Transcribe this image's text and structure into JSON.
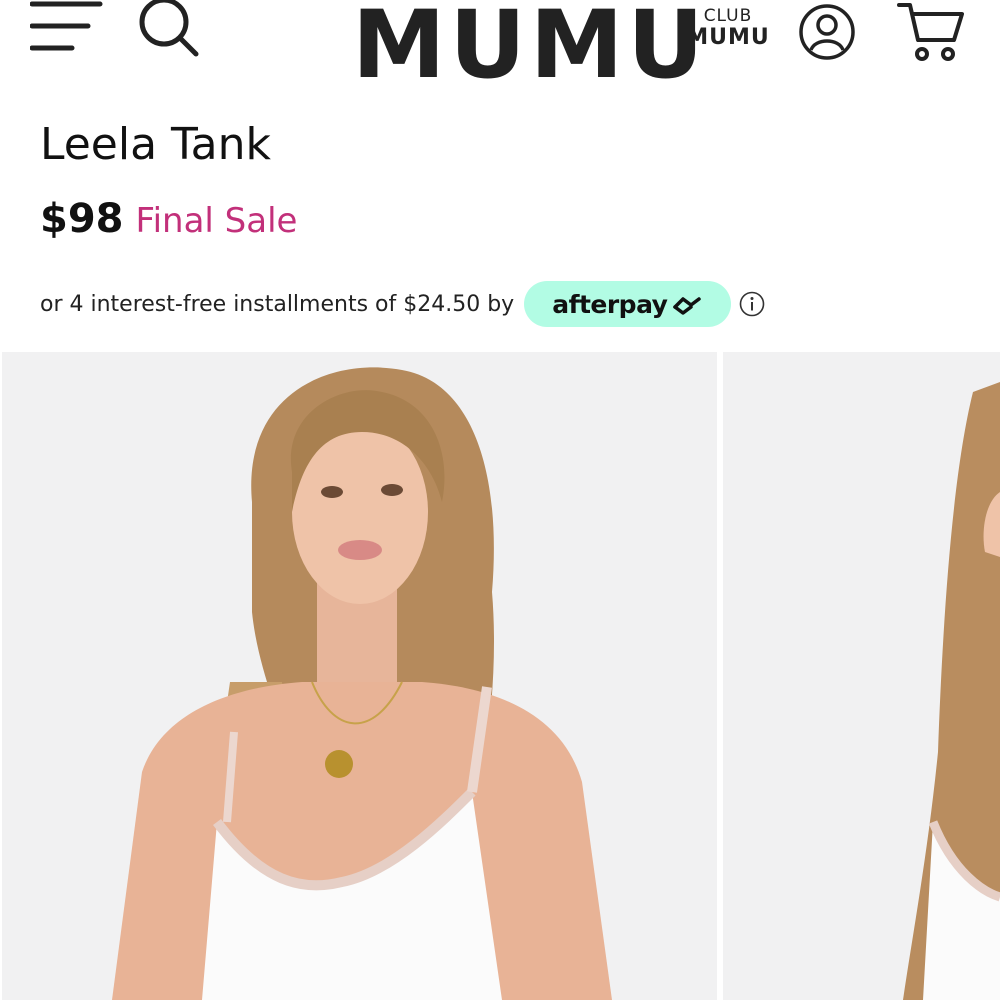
{
  "header": {
    "logo": "MUMU",
    "club_line1": "CLUB",
    "club_line2": "MUMU",
    "icons": [
      "menu-icon",
      "search-icon",
      "account-icon",
      "cart-icon"
    ]
  },
  "product": {
    "name": "Leela Tank",
    "price": "$98",
    "sale_label": "Final Sale",
    "installment_text": "or 4 interest-free installments of $24.50 by",
    "payment_provider": "afterpay",
    "info_icon": "info-icon"
  },
  "colors": {
    "sale": "#c2307a",
    "afterpay_badge": "#b2fce4",
    "text": "#111111",
    "photo_background": "#f1f1f2"
  },
  "gallery": {
    "image_count_visible": 2,
    "images": [
      "product-photo-front",
      "product-photo-side"
    ]
  }
}
